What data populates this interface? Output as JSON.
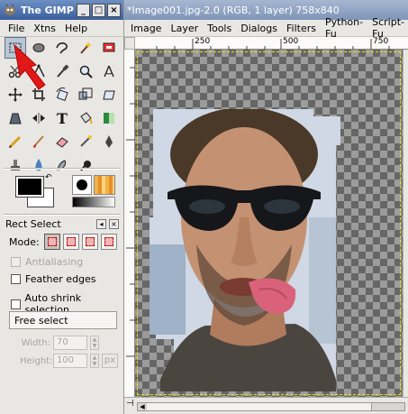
{
  "toolbox": {
    "title": "The GIMP",
    "window_buttons": [
      "_",
      "□",
      "×"
    ],
    "menu": [
      "File",
      "Xtns",
      "Help"
    ],
    "tools": [
      {
        "name": "rect-select-tool-icon",
        "active": true
      },
      {
        "name": "ellipse-select-tool-icon"
      },
      {
        "name": "free-select-tool-icon"
      },
      {
        "name": "fuzzy-select-tool-icon"
      },
      {
        "name": "select-by-color-tool-icon"
      },
      {
        "name": "scissors-tool-icon"
      },
      {
        "name": "paths-tool-icon"
      },
      {
        "name": "color-picker-tool-icon"
      },
      {
        "name": "magnify-tool-icon"
      },
      {
        "name": "measure-tool-icon"
      },
      {
        "name": "move-tool-icon"
      },
      {
        "name": "crop-tool-icon"
      },
      {
        "name": "rotate-tool-icon"
      },
      {
        "name": "scale-tool-icon"
      },
      {
        "name": "shear-tool-icon"
      },
      {
        "name": "perspective-tool-icon"
      },
      {
        "name": "flip-tool-icon"
      },
      {
        "name": "text-tool-icon",
        "glyph": "T"
      },
      {
        "name": "bucket-fill-tool-icon"
      },
      {
        "name": "blend-tool-icon"
      },
      {
        "name": "pencil-tool-icon"
      },
      {
        "name": "paintbrush-tool-icon"
      },
      {
        "name": "eraser-tool-icon"
      },
      {
        "name": "airbrush-tool-icon"
      },
      {
        "name": "ink-tool-icon"
      },
      {
        "name": "clone-tool-icon"
      },
      {
        "name": "blur-sharpen-tool-icon"
      },
      {
        "name": "smudge-tool-icon"
      },
      {
        "name": "dodge-burn-tool-icon"
      }
    ],
    "options": {
      "title": "Rect Select",
      "mode_label": "Mode:",
      "antialiasing": "Antialiasing",
      "feather_edges": "Feather edges",
      "auto_shrink": "Auto shrink selection",
      "select_mode": "Free select",
      "width_label": "Width:",
      "width_value": "70",
      "height_label": "Height:",
      "height_value": "100",
      "unit": "px"
    }
  },
  "image_window": {
    "title": "*Image001.jpg-2.0 (RGB, 1 layer) 758x840",
    "menu": [
      "Image",
      "Layer",
      "Tools",
      "Dialogs",
      "Filters",
      "Python-Fu",
      "Script-Fu"
    ],
    "ruler_labels": [
      "250",
      "500",
      "750"
    ]
  },
  "colors": {
    "accent": "#3a5f9e",
    "pointer": "#e01818"
  }
}
